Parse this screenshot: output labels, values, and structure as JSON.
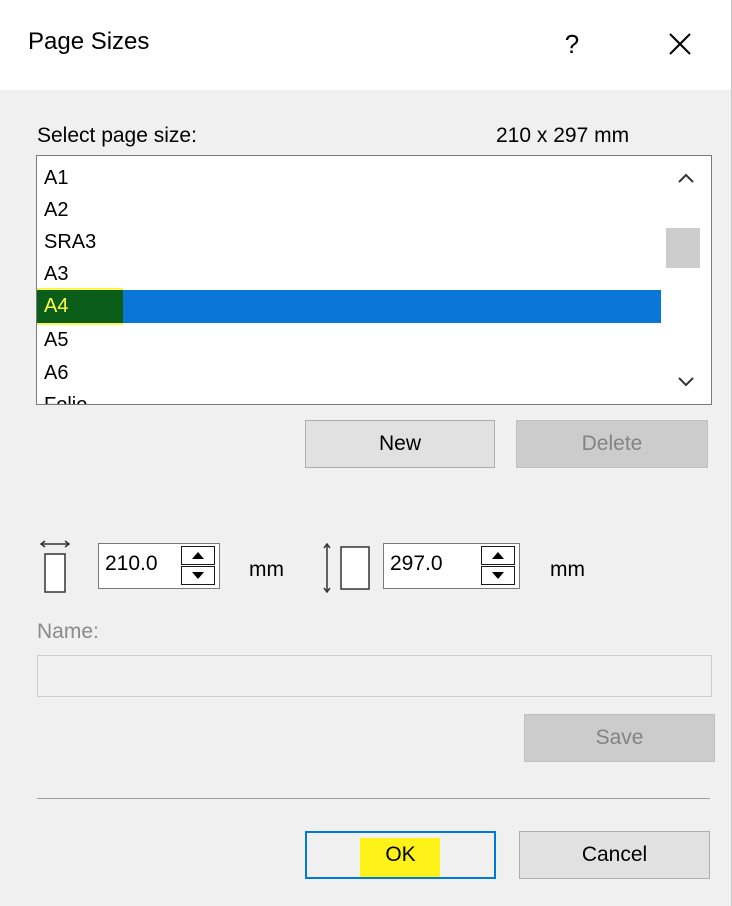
{
  "dialog": {
    "title": "Page Sizes",
    "help_label": "?",
    "close_icon": "close-icon"
  },
  "page_size": {
    "label": "Select page size:",
    "current_size": "210 x 297 mm",
    "items": [
      "A1",
      "A2",
      "SRA3",
      "A3",
      "A4",
      "A5",
      "A6",
      "Folio"
    ],
    "selected": "A4"
  },
  "buttons": {
    "new": "New",
    "delete": "Delete",
    "save": "Save",
    "ok": "OK",
    "cancel": "Cancel"
  },
  "dimensions": {
    "width_value": "210.0",
    "height_value": "297.0",
    "unit": "mm"
  },
  "name": {
    "label": "Name:",
    "value": ""
  },
  "colors": {
    "selection": "#0a77d6",
    "highlighter": "#fff200",
    "default_button_border": "#0078d7"
  }
}
